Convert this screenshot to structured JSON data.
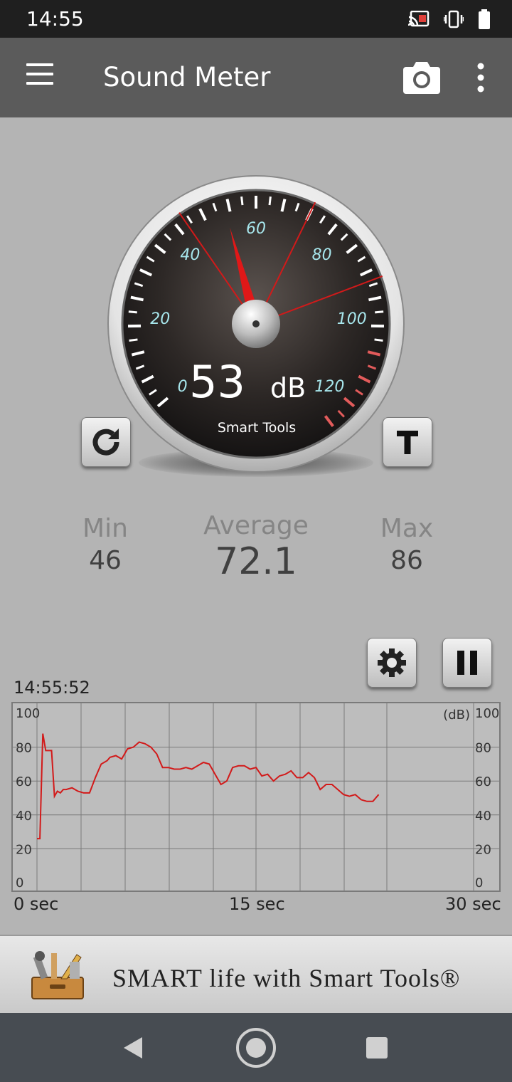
{
  "status_bar": {
    "time": "14:55"
  },
  "app_bar": {
    "title": "Sound Meter"
  },
  "gauge": {
    "reading_value": "53",
    "reading_unit": "dB",
    "brand": "Smart Tools",
    "scale_labels": [
      "0",
      "20",
      "40",
      "60",
      "80",
      "100",
      "120"
    ],
    "needle_db": 53,
    "red_marker_lines_db": [
      44,
      72,
      92
    ]
  },
  "stats": {
    "min_label": "Min",
    "min_value": "46",
    "average_label": "Average",
    "average_value": "72.1",
    "max_label": "Max",
    "max_value": "86"
  },
  "chart": {
    "start_time": "14:55:52",
    "unit_label": "(dB)",
    "y_ticks": [
      "100",
      "80",
      "60",
      "40",
      "20",
      "0"
    ],
    "x_labels": [
      "0 sec",
      "15 sec",
      "30 sec"
    ],
    "line_color": "#d21a1a"
  },
  "chart_data": {
    "type": "line",
    "title": "",
    "xlabel": "",
    "ylabel": "(dB)",
    "xlim": [
      0,
      30
    ],
    "ylim": [
      0,
      100
    ],
    "x": [
      0,
      0.2,
      0.4,
      0.6,
      0.8,
      1.0,
      1.2,
      1.4,
      1.6,
      1.8,
      2.0,
      2.4,
      2.8,
      3.2,
      3.6,
      4.0,
      4.4,
      4.8,
      5.0,
      5.4,
      5.8,
      6.2,
      6.6,
      7.0,
      7.4,
      7.8,
      8.2,
      8.6,
      9.0,
      9.4,
      9.8,
      10.2,
      10.6,
      11.0,
      11.4,
      11.8,
      12.2,
      12.6,
      13.0,
      13.4,
      13.8,
      14.2,
      14.6,
      15.0,
      15.4,
      15.8,
      16.2,
      16.6,
      17.0,
      17.4,
      17.8,
      18.2,
      18.6,
      19.0,
      19.4,
      19.8,
      20.2,
      20.6,
      21.0,
      21.4,
      21.8,
      22.2,
      22.6,
      23.0,
      23.4
    ],
    "series": [
      {
        "values": [
          26,
          26,
          88,
          78,
          78,
          78,
          51,
          54,
          53,
          55,
          55,
          56,
          54,
          53,
          53,
          62,
          70,
          72,
          74,
          75,
          73,
          79,
          80,
          83,
          82,
          80,
          76,
          68,
          68,
          67,
          67,
          68,
          67,
          69,
          71,
          70,
          64,
          58,
          60,
          68,
          69,
          69,
          67,
          68,
          63,
          64,
          60,
          63,
          64,
          66,
          62,
          62,
          65,
          62,
          55,
          58,
          58,
          55,
          52,
          51,
          52,
          49,
          48,
          48,
          52
        ]
      }
    ]
  },
  "ad_banner": {
    "text": "SMART life with Smart Tools®"
  }
}
